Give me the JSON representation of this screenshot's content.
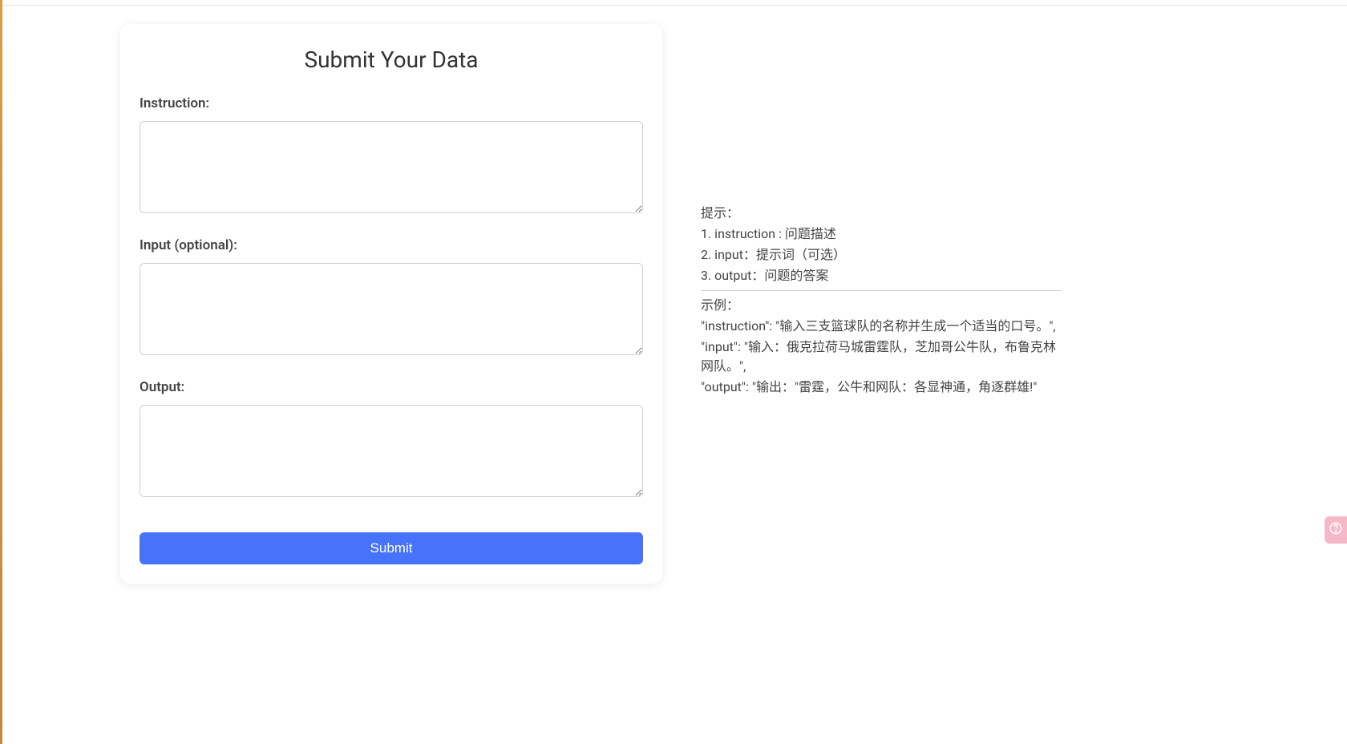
{
  "form": {
    "title": "Submit Your Data",
    "instruction_label": "Instruction:",
    "instruction_value": "",
    "input_label": "Input (optional):",
    "input_value": "",
    "output_label": "Output:",
    "output_value": "",
    "submit_label": "Submit"
  },
  "hints": {
    "title": "提示：",
    "items": [
      "1. instruction : 问题描述",
      "2. input：提示词（可选）",
      "3. output：问题的答案"
    ],
    "example_title": "示例：",
    "example_lines": [
      "\"instruction\": \"输入三支篮球队的名称并生成一个适当的口号。\",",
      "\"input\": \"输入：俄克拉荷马城雷霆队，芝加哥公牛队，布鲁克林网队。\",",
      "\"output\": \"输出：\"雷霆，公牛和网队：各显神通，角逐群雄!\""
    ]
  }
}
